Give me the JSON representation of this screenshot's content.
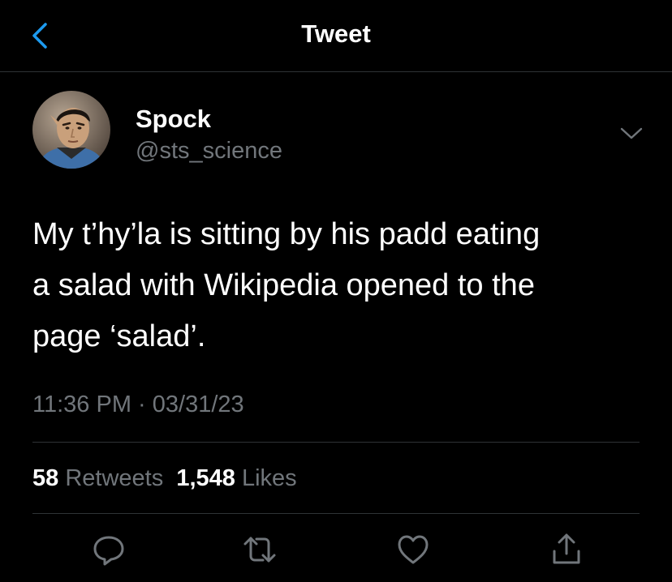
{
  "header": {
    "title": "Tweet",
    "back_icon": "chevron-left-icon"
  },
  "author": {
    "name": "Spock",
    "handle": "@sts_science",
    "avatar": "avatar-photo"
  },
  "tweet": {
    "text_lines": [
      "My t’hy’la is sitting by his padd eating",
      "a salad with Wikipedia opened to the",
      "page ‘salad’."
    ],
    "time": "11:36 PM",
    "separator": "·",
    "date": "03/31/23"
  },
  "stats": {
    "retweets_count": "58",
    "retweets_label": "Retweets",
    "likes_count": "1,548",
    "likes_label": "Likes"
  },
  "actions": [
    "reply-icon",
    "retweet-icon",
    "like-icon",
    "share-icon"
  ],
  "colors": {
    "background": "#000000",
    "text": "#ffffff",
    "secondary_text": "#71767b",
    "accent": "#1d9bf0",
    "divider": "#2f3336"
  }
}
